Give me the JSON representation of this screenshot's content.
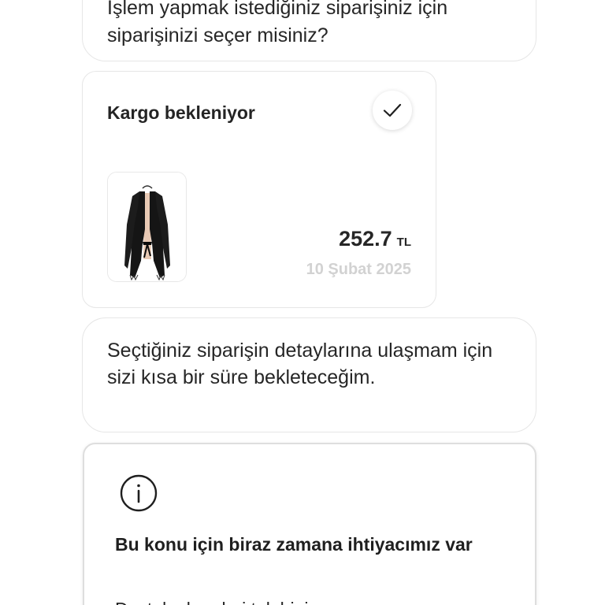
{
  "chat": {
    "messages": [
      {
        "type": "bot_text",
        "text": "İşlem yapmak istediğiniz siparişiniz için siparişinizi seçer misiniz?"
      },
      {
        "type": "bot_text",
        "text": "Seçtiğiniz siparişin detaylarına ulaşmam için sizi kısa bir süre bekleteceğim."
      }
    ]
  },
  "order_card": {
    "status": "Kargo bekleniyor",
    "selected": true,
    "selected_icon": "checkmark-icon",
    "product_image": "black-cardigan-product-image",
    "price": "252.7",
    "currency": "TL",
    "date": "10 Şubat 2025"
  },
  "info_card": {
    "icon": "info-icon",
    "title": "Bu konu için biraz zamana ihtiyacımız var",
    "body_partial": "Destek ekranleri talebiniz..."
  },
  "colors": {
    "background": "#ffffff",
    "bubble_border": "#e6e6e6",
    "text_primary": "#262626",
    "date_text": "#d2d2d2"
  }
}
